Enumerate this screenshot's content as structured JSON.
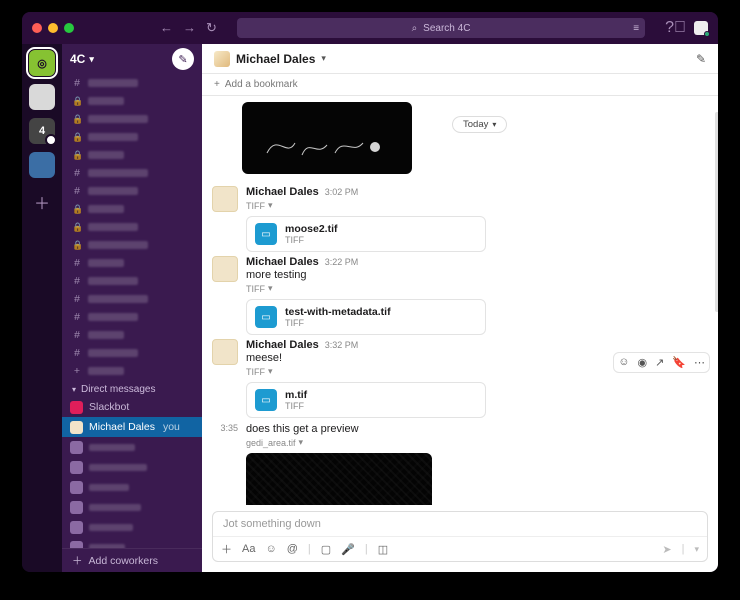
{
  "titlebar": {
    "search_placeholder": "Search 4C"
  },
  "workspace": {
    "name": "4C",
    "badge": "4"
  },
  "sidebar": {
    "sections": {
      "dms": "Direct messages"
    },
    "dms": [
      {
        "name": "Slackbot"
      },
      {
        "name": "Michael Dales",
        "you": "you",
        "selected": true
      }
    ],
    "footer": "Add coworkers"
  },
  "header": {
    "title": "Michael Dales",
    "bookmark": "Add a bookmark"
  },
  "divider": {
    "label": "Today"
  },
  "messages": [
    {
      "author": "Michael Dales",
      "time": "3:02 PM",
      "filetype_label": "TIFF",
      "file": {
        "name": "moose2.tif",
        "type": "TIFF"
      }
    },
    {
      "author": "Michael Dales",
      "time": "3:22 PM",
      "text": "more testing",
      "filetype_label": "TIFF",
      "file": {
        "name": "test-with-metadata.tif",
        "type": "TIFF"
      }
    },
    {
      "author": "Michael Dales",
      "time": "3:32 PM",
      "text": "meese!",
      "filetype_label": "TIFF",
      "file": {
        "name": "m.tif",
        "type": "TIFF"
      }
    },
    {
      "time": "3:35",
      "text": "does this get a preview",
      "attachment_label": "gedi_area.tif"
    }
  ],
  "composer": {
    "placeholder": "Jot something down"
  }
}
